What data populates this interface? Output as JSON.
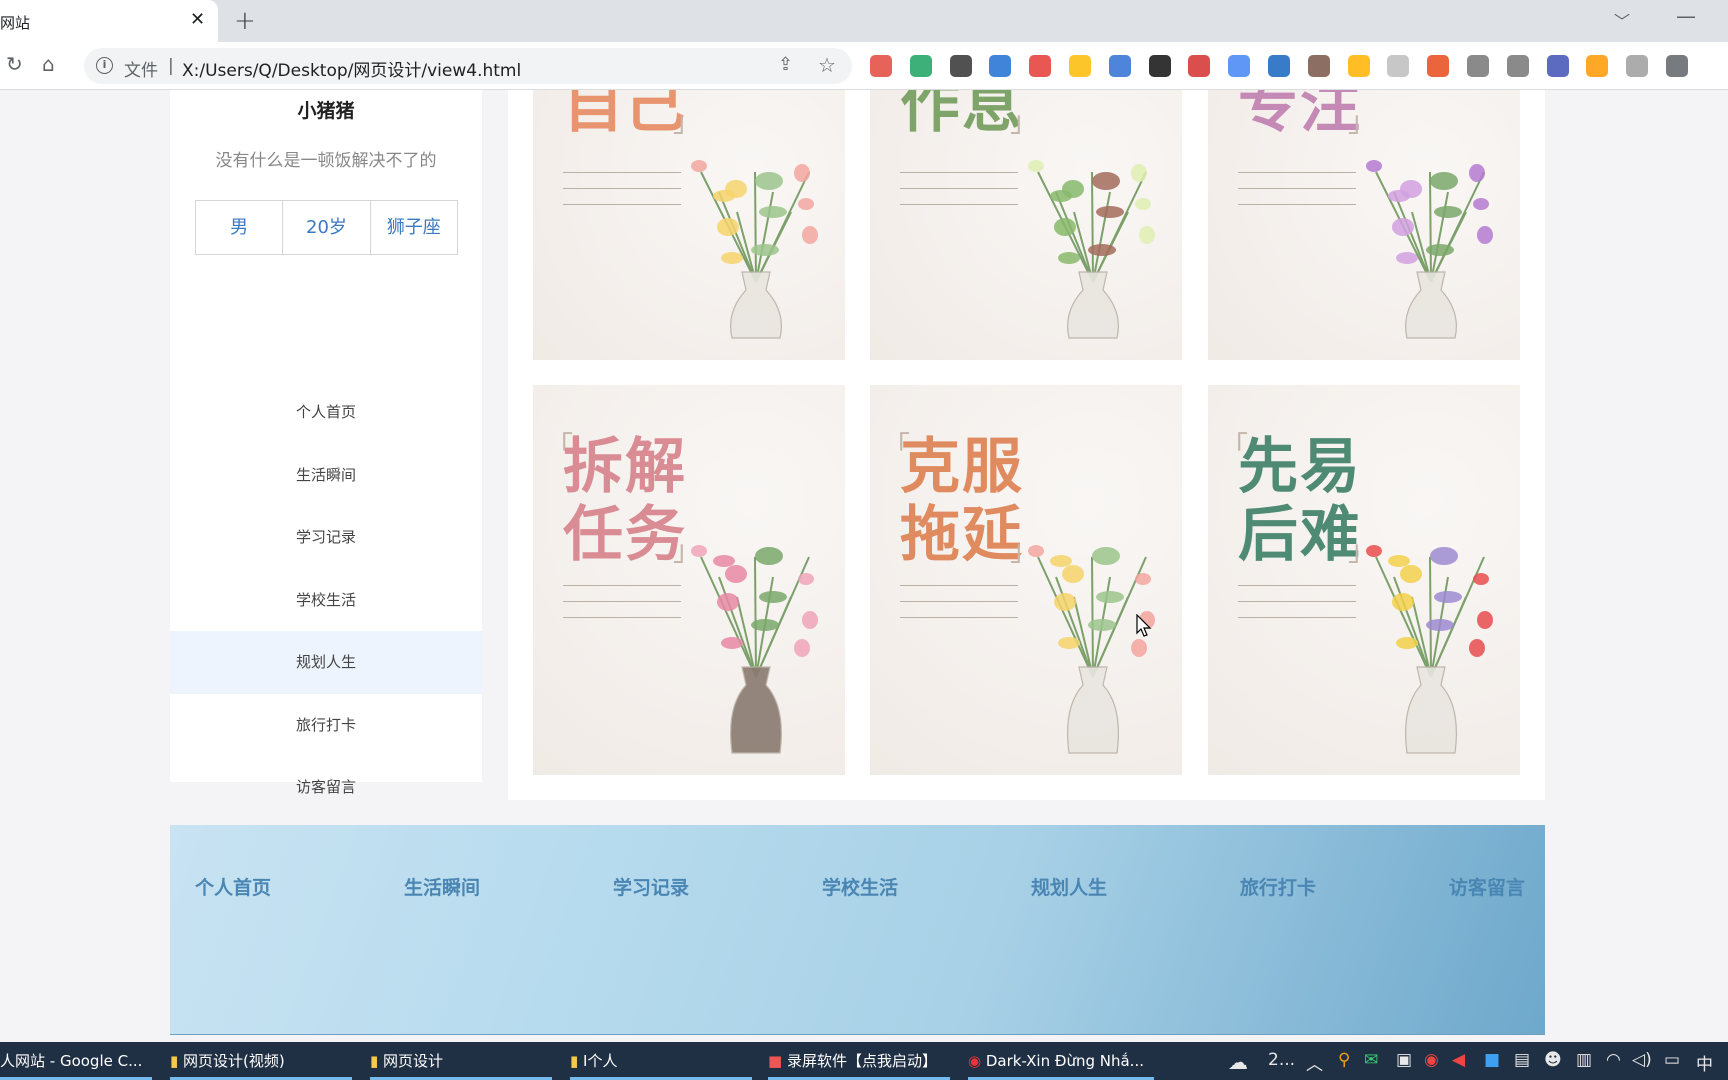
{
  "browser": {
    "tab_title": "网站",
    "url_label": "文件",
    "url": "X:/Users/Q/Desktop/网页设计/view4.html",
    "extension_colors": [
      "#e3483c",
      "#1aa260",
      "#333333",
      "#1d6fd1",
      "#e53935",
      "#fbbc05",
      "#2f6fd4",
      "#111111",
      "#d32f2f",
      "#4285f4",
      "#1565c0",
      "#795548",
      "#ffb300",
      "#bdbdbd",
      "#e64a19",
      "#757575",
      "#757575",
      "#3f51b5",
      "#ff9800",
      "#9e9e9e",
      "#5f6368"
    ]
  },
  "profile": {
    "name": "小猪猪",
    "motto": "没有什么是一顿饭解决不了的",
    "gender": "男",
    "age": "20岁",
    "sign": "狮子座"
  },
  "menu": [
    {
      "label": "个人首页"
    },
    {
      "label": "生活瞬间"
    },
    {
      "label": "学习记录"
    },
    {
      "label": "学校生活"
    },
    {
      "label": "规划人生",
      "active": true
    },
    {
      "label": "旅行打卡"
    },
    {
      "label": "访客留言"
    }
  ],
  "cards": [
    {
      "title": "自己",
      "color": "#e8956f"
    },
    {
      "title": "作息",
      "color": "#7fa46a"
    },
    {
      "title": "专注",
      "color": "#c48ab5"
    },
    {
      "title": "拆解\n任务",
      "color": "#d98c94"
    },
    {
      "title": "克服\n拖延",
      "color": "#e08a5f"
    },
    {
      "title": "先易\n后难",
      "color": "#4f8a75"
    }
  ],
  "footer": {
    "links": [
      "个人首页",
      "生活瞬间",
      "学习记录",
      "学校生活",
      "规划人生",
      "旅行打卡",
      "访客留言"
    ]
  },
  "taskbar": {
    "items": [
      {
        "label": "人网站 - Google C..."
      },
      {
        "label": "网页设计(视频)"
      },
      {
        "label": "网页设计"
      },
      {
        "label": "I个人"
      },
      {
        "label": "录屏软件【点我启动】"
      },
      {
        "label": "Dark-Xin Đừng Nhắ..."
      }
    ],
    "tray_text": "2...",
    "ime": "中"
  }
}
